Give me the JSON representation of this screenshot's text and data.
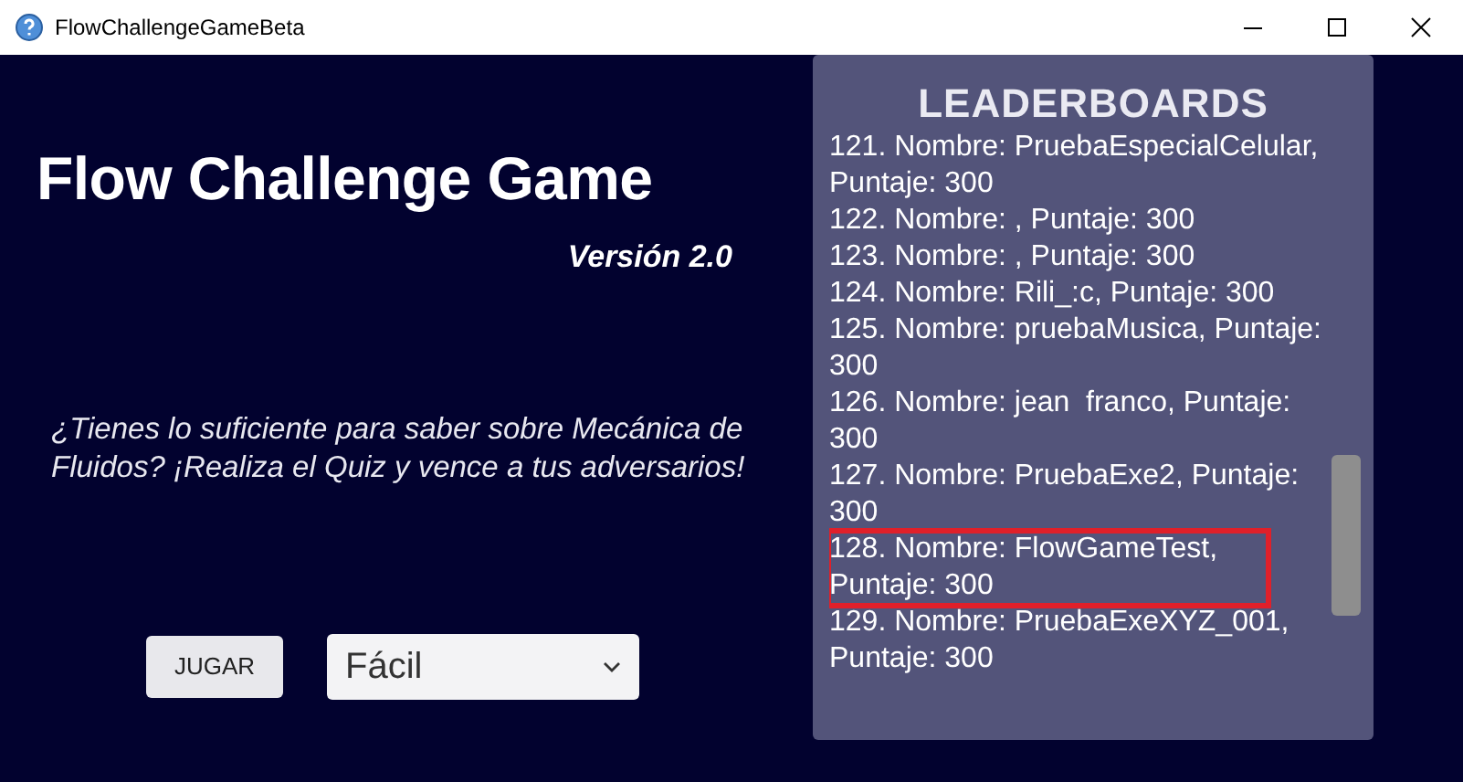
{
  "window": {
    "title": "FlowChallengeGameBeta"
  },
  "game": {
    "title": "Flow Challenge Game",
    "version": "Versión 2.0",
    "tagline": "¿Tienes lo suficiente para saber sobre Mecánica de Fluidos? ¡Realiza el Quiz y vence a tus adversarios!",
    "play_button": "JUGAR",
    "difficulty": {
      "value": "Fácil"
    }
  },
  "leaderboard": {
    "title": "LEADERBOARDS",
    "entries": [
      {
        "text": "121. Nombre: PruebaEspecialCelular, Puntaje: 300",
        "selected": false
      },
      {
        "text": "122. Nombre: , Puntaje: 300",
        "selected": false
      },
      {
        "text": "123. Nombre: , Puntaje: 300",
        "selected": false
      },
      {
        "text": "124. Nombre: Rili_:c, Puntaje: 300",
        "selected": false
      },
      {
        "text": "125. Nombre: pruebaMusica, Puntaje: 300",
        "selected": false
      },
      {
        "text": "126. Nombre: jean  franco, Puntaje: 300",
        "selected": false
      },
      {
        "text": "127. Nombre: PruebaExe2, Puntaje: 300",
        "selected": false
      },
      {
        "text": "128. Nombre: FlowGameTest, Puntaje: 300",
        "selected": true
      },
      {
        "text": "129. Nombre: PruebaExeXYZ_001, Puntaje: 300",
        "selected": false
      }
    ]
  }
}
